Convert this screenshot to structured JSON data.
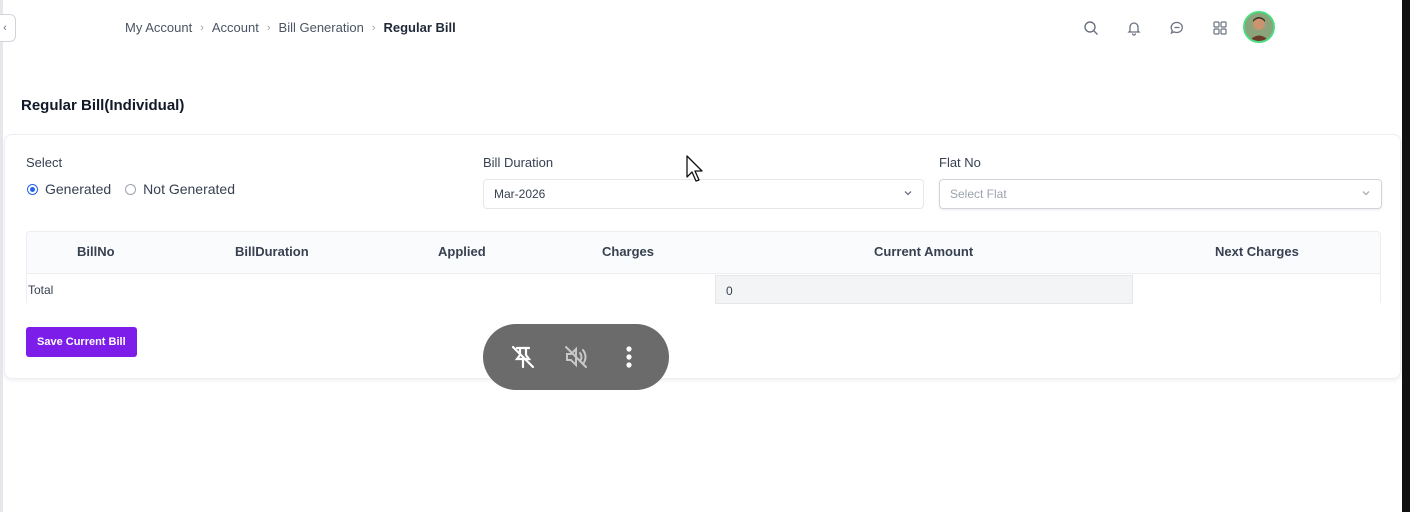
{
  "breadcrumb": {
    "items": [
      "My Account",
      "Account",
      "Bill Generation"
    ],
    "current": "Regular Bill",
    "separator": "›"
  },
  "sidebar_toggle": {
    "icon": "chevron-left-icon",
    "glyph": "‹"
  },
  "header_icons": [
    "search-icon",
    "bell-icon",
    "chat-icon",
    "apps-grid-icon"
  ],
  "avatar": {
    "icon": "user-avatar"
  },
  "page": {
    "title": "Regular Bill(Individual)"
  },
  "filters": {
    "select": {
      "label": "Select",
      "options": [
        {
          "label": "Generated",
          "checked": true
        },
        {
          "label": "Not Generated",
          "checked": false
        }
      ]
    },
    "bill_duration": {
      "label": "Bill Duration",
      "value": "Mar-2026"
    },
    "flat_no": {
      "label": "Flat No",
      "placeholder": "Select Flat"
    }
  },
  "table": {
    "columns": [
      "BillNo",
      "BillDuration",
      "Applied",
      "Charges",
      "Current Amount",
      "Next Charges"
    ],
    "total": {
      "label": "Total",
      "value": "0"
    }
  },
  "actions": {
    "save_label": "Save Current Bill"
  },
  "media_overlay": {
    "icons": [
      "unpin-icon",
      "mute-icon",
      "more-vertical-icon"
    ]
  },
  "colors": {
    "accent": "#7c1de9",
    "radio_checked": "#2563eb",
    "overlay_bg": "#6b6b6b"
  }
}
